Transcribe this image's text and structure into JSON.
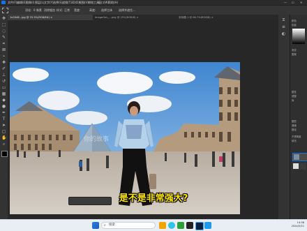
{
  "menubar": {
    "items": [
      "文件(F)",
      "编辑(E)",
      "图像(I)",
      "图层(L)",
      "文字(Y)",
      "选择(S)",
      "滤镜(T)",
      "3D(D)",
      "视图(V)",
      "增效工具",
      "窗口(W)",
      "帮助(H)"
    ],
    "window_controls": [
      "—",
      "☐",
      "✕"
    ]
  },
  "options_bar": {
    "feather_label": "羽化:",
    "feather_value": "0 像素",
    "antialias_label": "消除锯齿",
    "style_label": "样式:",
    "style_value": "正常",
    "width_label": "宽度:",
    "height_label": "高度:",
    "select_subject": "选择主体",
    "select_and_mask": "选择并遮住..."
  },
  "tabs": [
    {
      "label": "1e20d8...jpg @ 33.3%(RGB/8#) ×",
      "active": true
    },
    {
      "label": "ImageGen_...png @ 25%(RGB/8) ×",
      "active": false
    },
    {
      "label": "未标题-1 @ 66.7%(RGB/8) ×",
      "active": false
    }
  ],
  "right_panel": {
    "labels": [
      "颜色",
      "色板",
      "渐变",
      "图案",
      "属性",
      "调整",
      "库",
      "图层",
      "通道",
      "路径",
      "不透明度",
      "填充"
    ]
  },
  "subtitle": "是不是非常强大?",
  "watermark": "你的故事",
  "taskbar": {
    "search_placeholder": "搜索",
    "time": "14:38",
    "date": "2024/5/21"
  },
  "icons": [
    "search-icon",
    "windows-start-icon",
    "photoshop-logo-icon"
  ]
}
